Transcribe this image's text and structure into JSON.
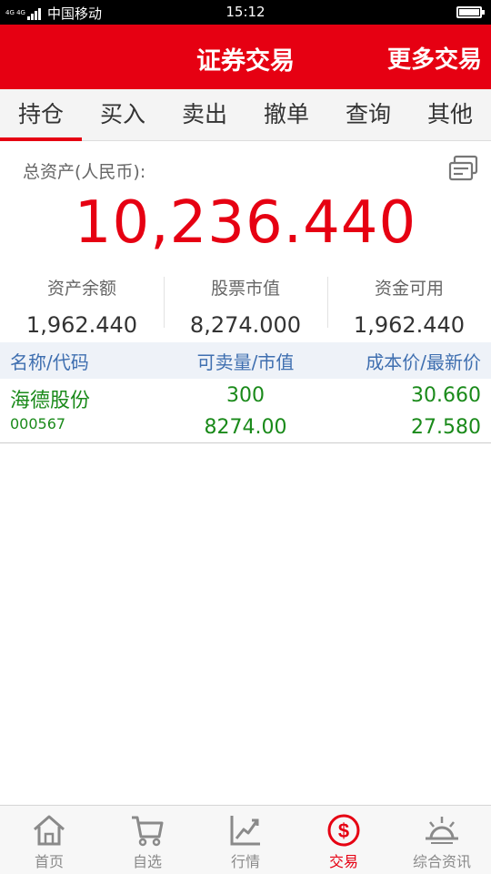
{
  "status_bar": {
    "network": "4G 4G",
    "carrier": "中国移动",
    "time": "15:12"
  },
  "header": {
    "title": "证券交易",
    "more": "更多交易"
  },
  "tabs": [
    {
      "label": "持仓",
      "active": true
    },
    {
      "label": "买入"
    },
    {
      "label": "卖出"
    },
    {
      "label": "撤单"
    },
    {
      "label": "查询"
    },
    {
      "label": "其他"
    }
  ],
  "assets": {
    "label": "总资产(人民币):",
    "total": "10,236.440",
    "summary": [
      {
        "label": "资产余额",
        "value": "1,962.440"
      },
      {
        "label": "股票市值",
        "value": "8,274.000"
      },
      {
        "label": "资金可用",
        "value": "1,962.440"
      }
    ]
  },
  "table": {
    "headers": {
      "name": "名称/代码",
      "qty": "可卖量/市值",
      "cost": "成本价/最新价"
    },
    "rows": [
      {
        "name": "海德股份",
        "code": "000567",
        "qty": "300",
        "market_value": "8274.00",
        "cost_price": "30.660",
        "last_price": "27.580"
      }
    ]
  },
  "bottom_nav": [
    {
      "label": "首页",
      "icon": "home-icon"
    },
    {
      "label": "自选",
      "icon": "cart-icon"
    },
    {
      "label": "行情",
      "icon": "chart-icon"
    },
    {
      "label": "交易",
      "icon": "dollar-icon",
      "active": true
    },
    {
      "label": "综合资讯",
      "icon": "sunrise-icon"
    }
  ],
  "colors": {
    "brand_red": "#e60012",
    "gain_green": "#1a8a1a",
    "header_blue": "#3f6fb0"
  }
}
